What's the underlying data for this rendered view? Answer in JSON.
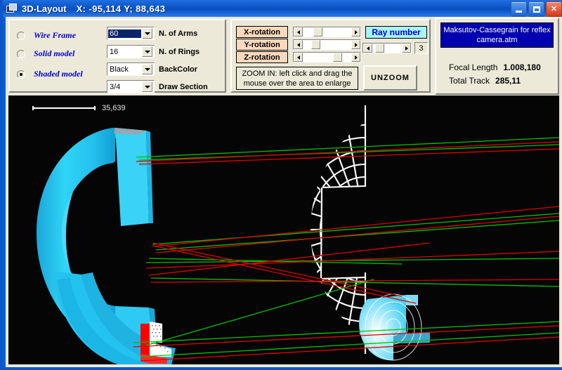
{
  "window": {
    "title": "3D-Layout",
    "coords": "X:  -95,114   Y;  88,643",
    "icon": "layout-icon",
    "buttons": {
      "minimize": "minimize-button",
      "maximize": "maximize-button",
      "close": "close-button"
    }
  },
  "model_panel": {
    "radios": [
      {
        "label": "Wire Frame",
        "selected": false
      },
      {
        "label": "Solid model",
        "selected": false
      },
      {
        "label": "Shaded model",
        "selected": true
      }
    ],
    "combos": [
      {
        "value": "60",
        "label": "N. of Arms",
        "focused": true
      },
      {
        "value": "16",
        "label": "N. of Rings",
        "focused": false
      },
      {
        "value": "Black",
        "label": "BackColor",
        "focused": false
      },
      {
        "value": "3/4",
        "label": "Draw Section",
        "focused": false
      }
    ]
  },
  "rotation_panel": {
    "rows": [
      {
        "label": "X-rotation",
        "thumb_pct": 22
      },
      {
        "label": "Y-rotation",
        "thumb_pct": 18
      },
      {
        "label": "Z-rotation",
        "thumb_pct": 62
      }
    ],
    "ray": {
      "title": "Ray number",
      "value": "3",
      "thumb_pct": 20
    },
    "zoom_hint_line1": "ZOOM IN: left click and drag the",
    "zoom_hint_line2": "mouse over the area to enlarge",
    "unzoom_label": "UNZOOM"
  },
  "info_panel": {
    "system_name_line1": "Maksutov-Cassegrain for reflex",
    "system_name_line2": "camera.atm",
    "rows": [
      {
        "key": "Focal Length",
        "value": "1.008,180"
      },
      {
        "key": "Total Track",
        "value": "285,11"
      }
    ]
  },
  "viewport": {
    "scale_value": "35,639",
    "background_color": "#050505",
    "shaded_color": "#29c8f0",
    "wireframe_color": "#ffffff",
    "ray_colors": [
      "#e00000",
      "#00c000"
    ]
  }
}
